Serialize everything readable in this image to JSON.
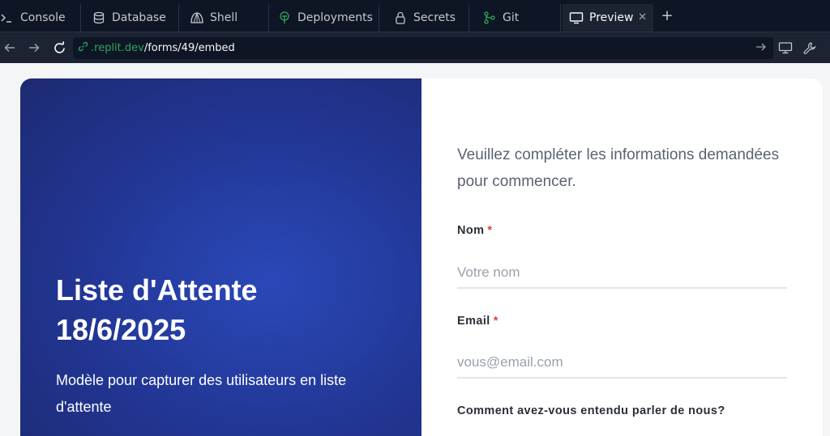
{
  "tabs": [
    {
      "label": "Console",
      "icon": "console-icon"
    },
    {
      "label": "Database",
      "icon": "database-icon"
    },
    {
      "label": "Shell",
      "icon": "shell-icon"
    },
    {
      "label": "Deployments",
      "icon": "deployments-icon"
    },
    {
      "label": "Secrets",
      "icon": "lock-icon"
    },
    {
      "label": "Git",
      "icon": "git-icon"
    },
    {
      "label": "Preview",
      "icon": "monitor-icon",
      "active": true
    }
  ],
  "address": {
    "host": ".replit.dev",
    "path": "/forms/49/embed"
  },
  "hero": {
    "title_line1": "Liste d'Attente",
    "title_line2": "18/6/2025",
    "subtitle": "Modèle pour capturer des utilisateurs en liste d'attente"
  },
  "form": {
    "intro": "Veuillez compléter les informations demandées pour commencer.",
    "name_label": "Nom",
    "name_placeholder": "Votre nom",
    "email_label": "Email",
    "email_placeholder": "vous@email.com",
    "required_marker": "*",
    "source_label": "Comment avez-vous entendu parler de nous?"
  },
  "colors": {
    "ide_background": "#0e1525",
    "url_host": "#2ea85a",
    "hero_blue": "#2a48b8",
    "required": "#e53e3e"
  }
}
